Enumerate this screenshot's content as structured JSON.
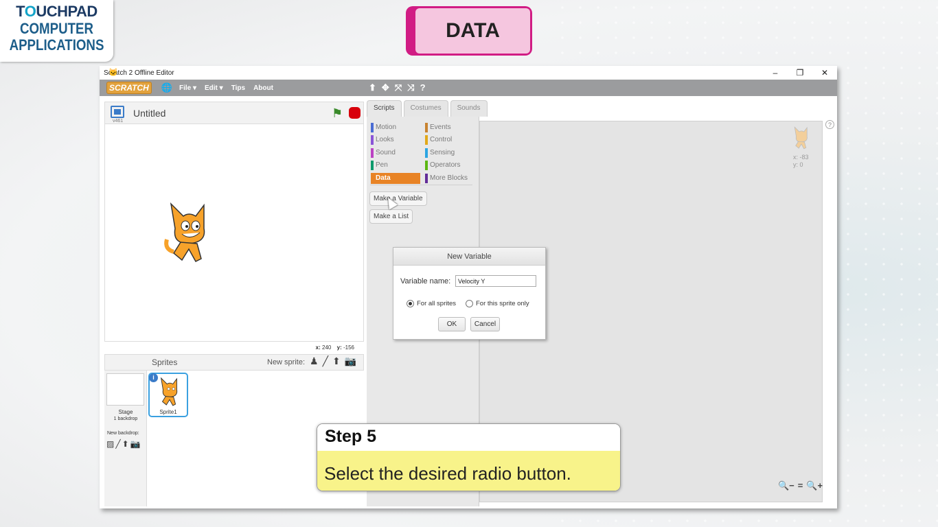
{
  "brand": {
    "line1_pre": "T",
    "line1_o": "O",
    "line1_post": "UCHPAD",
    "line2": "COMPUTER",
    "line3": "APPLICATIONS"
  },
  "heading": {
    "title": "DATA"
  },
  "window": {
    "title": "Scratch 2 Offline Editor",
    "minimize": "–",
    "restore": "❐",
    "close": "✕"
  },
  "menu": {
    "logo": "SCRATCH",
    "globe": "🌐",
    "file": "File ▾",
    "edit": "Edit ▾",
    "tips": "Tips",
    "about": "About",
    "tools": [
      "⬆",
      "✥",
      "⤧",
      "⤨",
      "?"
    ]
  },
  "stage": {
    "version": "v461",
    "project_name": "Untitled",
    "x_label": "x:",
    "x": "240",
    "y_label": "y:",
    "y": "-156"
  },
  "sprites": {
    "label": "Sprites",
    "new_sprite": "New sprite:",
    "new_sprite_icons": [
      "♟",
      "╱",
      "⬆",
      "📷"
    ],
    "stage_label": "Stage",
    "stage_sub": "1 backdrop",
    "new_backdrop": "New backdrop:",
    "backdrop_icons": [
      "▨",
      "╱",
      "⬆",
      "📷"
    ],
    "sprite_name": "Sprite1",
    "info": "i"
  },
  "tabs": [
    "Scripts",
    "Costumes",
    "Sounds"
  ],
  "categories": [
    {
      "label": "Motion",
      "color": "#4a6cd4"
    },
    {
      "label": "Looks",
      "color": "#8a55d7"
    },
    {
      "label": "Sound",
      "color": "#bb42c3"
    },
    {
      "label": "Pen",
      "color": "#0e9a6c"
    },
    {
      "label": "Data",
      "color": "#ee7d16"
    },
    {
      "label": "Events",
      "color": "#c88330"
    },
    {
      "label": "Control",
      "color": "#e1a91a"
    },
    {
      "label": "Sensing",
      "color": "#2ca5e2"
    },
    {
      "label": "Operators",
      "color": "#5cb712"
    },
    {
      "label": "More Blocks",
      "color": "#632d99"
    }
  ],
  "palette": {
    "make_variable": "Make a Variable",
    "make_list": "Make a List"
  },
  "scripts": {
    "help": "?",
    "x_readout": "x: -83",
    "y_readout": "y: 0",
    "zoom": [
      "🔍−",
      "=",
      "🔍+"
    ]
  },
  "dialog": {
    "title": "New Variable",
    "name_label": "Variable name:",
    "name_value": "Velocity Y",
    "radio_all": "For all sprites",
    "radio_this": "For this sprite only",
    "ok": "OK",
    "cancel": "Cancel"
  },
  "step": {
    "title": "Step 5",
    "description": "Select the desired radio button."
  }
}
